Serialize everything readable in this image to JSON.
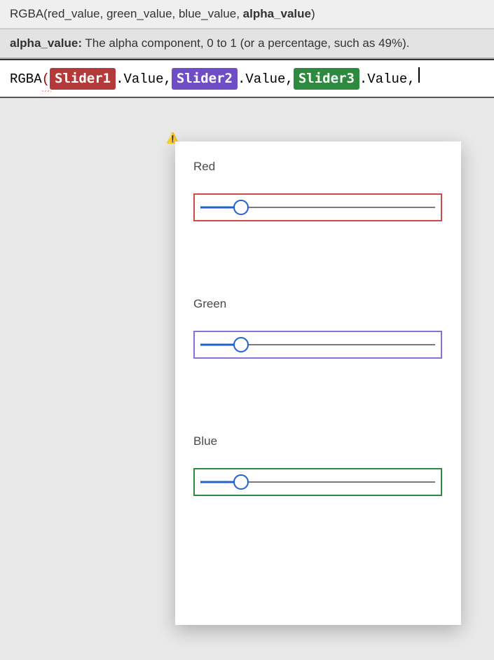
{
  "tooltip": {
    "signature_prefix": "RGBA(red_value, green_value, blue_value, ",
    "signature_current_param": "alpha_value",
    "signature_suffix": ")",
    "param_name": "alpha_value:",
    "param_desc": " The alpha component, 0 to 1 (or a percentage, such as 49%)."
  },
  "formula": {
    "fn": "RGBA",
    "open_paren": "(",
    "space": " ",
    "token1": "Slider1",
    "token2": "Slider2",
    "token3": "Slider3",
    "prop": ".Value",
    "comma": ", "
  },
  "canvas": {
    "sliders": [
      {
        "label": "Red",
        "color_class": "red",
        "fill_pct": 17,
        "thumb_pct": 17
      },
      {
        "label": "Green",
        "color_class": "purple",
        "fill_pct": 17,
        "thumb_pct": 17
      },
      {
        "label": "Blue",
        "color_class": "green",
        "fill_pct": 17,
        "thumb_pct": 17
      }
    ]
  },
  "icons": {
    "warning_glyph": "⚠️"
  }
}
